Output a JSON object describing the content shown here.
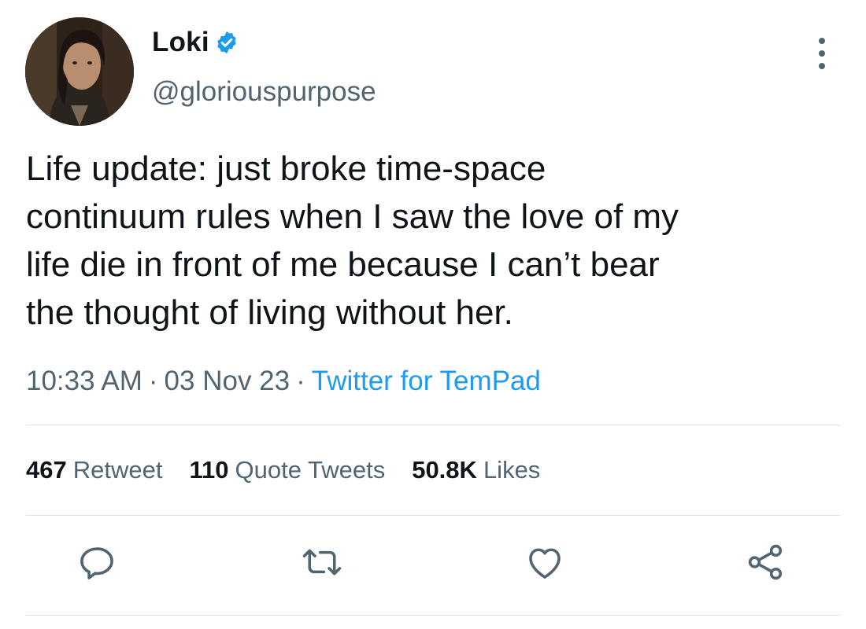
{
  "tweet": {
    "author_name": "Loki",
    "handle": "@gloriouspurpose",
    "text": "Life update: just broke time-space\ncontinuum rules when I saw the love of my\nlife die in front of me because I can’t bear\nthe thought of living without her.",
    "time": "10:33 AM",
    "separator": "·",
    "date": "03 Nov 23",
    "source": "Twitter for TemPad"
  },
  "stats": {
    "retweets_count": "467",
    "retweets_label": "Retweet",
    "quotes_count": "110",
    "quotes_label": "Quote Tweets",
    "likes_count": "50.8K",
    "likes_label": "Likes"
  },
  "icons": {
    "verified": "verified-badge-icon",
    "more": "more-options-icon",
    "reply": "reply-icon",
    "retweet": "retweet-icon",
    "like": "heart-icon",
    "share": "share-icon"
  },
  "colors": {
    "text": "#0f1419",
    "secondary": "#536471",
    "accent": "#1d9bf0"
  }
}
